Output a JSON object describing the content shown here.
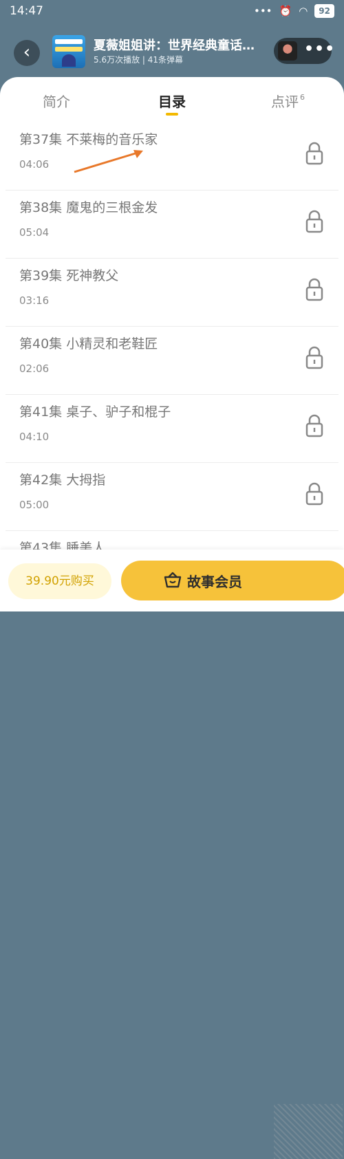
{
  "status_bar": {
    "time": "14:47",
    "battery": "92",
    "icons": [
      "signal-icon",
      "alarm-icon",
      "wifi-icon"
    ]
  },
  "header": {
    "title": "夏薇姐姐讲：世界经典童话故…",
    "subtitle": "5.6万次播放 | 41条弹幕"
  },
  "tabs": [
    {
      "label": "简介"
    },
    {
      "label": "目录"
    },
    {
      "label": "点评",
      "count": "6"
    }
  ],
  "episodes": [
    {
      "title": "第37集 不莱梅的音乐家",
      "duration": "04:06"
    },
    {
      "title": "第38集 魔鬼的三根金发",
      "duration": "05:04"
    },
    {
      "title": "第39集 死神教父",
      "duration": "03:16"
    },
    {
      "title": "第40集 小精灵和老鞋匠",
      "duration": "02:06"
    },
    {
      "title": "第41集 桌子、驴子和棍子",
      "duration": "04:10"
    },
    {
      "title": "第42集 大拇指",
      "duration": "05:00"
    },
    {
      "title": "第43集 睡美人",
      "duration": ""
    }
  ],
  "bottom": {
    "buy_label": "39.90元购买",
    "member_label": "故事会员"
  },
  "colors": {
    "accent": "#f3b900",
    "header_bg": "#5e7a8b",
    "annotation_arrow": "#e8782a"
  }
}
